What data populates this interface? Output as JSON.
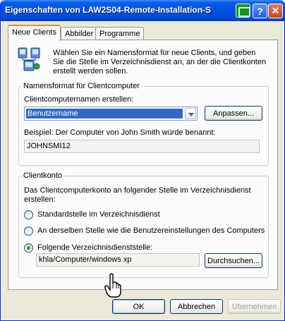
{
  "window": {
    "title": "Eigenschaften von LAW2S04-Remote-Installation-S",
    "help_glyph": "?",
    "close_glyph": "✕",
    "tray_icon": "network-status-icon"
  },
  "tabs": [
    {
      "label": "Neue Clients",
      "active": true
    },
    {
      "label": "Abbilder",
      "active": false
    },
    {
      "label": "Programme",
      "active": false
    }
  ],
  "intro": {
    "icon": "computer-network-icon",
    "text": "Wählen Sie ein Namensformat für neue Clients, und geben Sie die Stelle im Verzeichnisdienst an, an der die Clientkonten erstellt werden sollen."
  },
  "name_format": {
    "legend": "Namensformat für Clientcomputer",
    "create_label": "Clientcomputernamen erstellen:",
    "selected_format": "Benutzername",
    "customize_button": "Anpassen...",
    "example_label": "Beispiel: Der Computer von John Smith würde benannt:",
    "example_value": "JOHNSMI12"
  },
  "client_account": {
    "legend": "Clientkonto",
    "description": "Das Clientcomputerkonto an folgender Stelle im Verzeichnisdienst erstellen:",
    "options": [
      {
        "label": "Standardstelle im Verzeichnisdienst",
        "checked": false
      },
      {
        "label": "An derselben Stelle wie die Benutzereinstellungen des Computers",
        "checked": false
      },
      {
        "label": "Folgende Verzeichnisdienststelle:",
        "checked": true
      }
    ],
    "location_value": "khla/Computer/windows xp",
    "browse_button": "Durchsuchen..."
  },
  "buttons": {
    "ok": "OK",
    "cancel": "Abbrechen",
    "apply": "Übernehmen"
  },
  "colors": {
    "titlebar": "#0054e3",
    "selection": "#316ac5",
    "window_bg": "#ece9d8",
    "radio_checked": "#21a121"
  }
}
